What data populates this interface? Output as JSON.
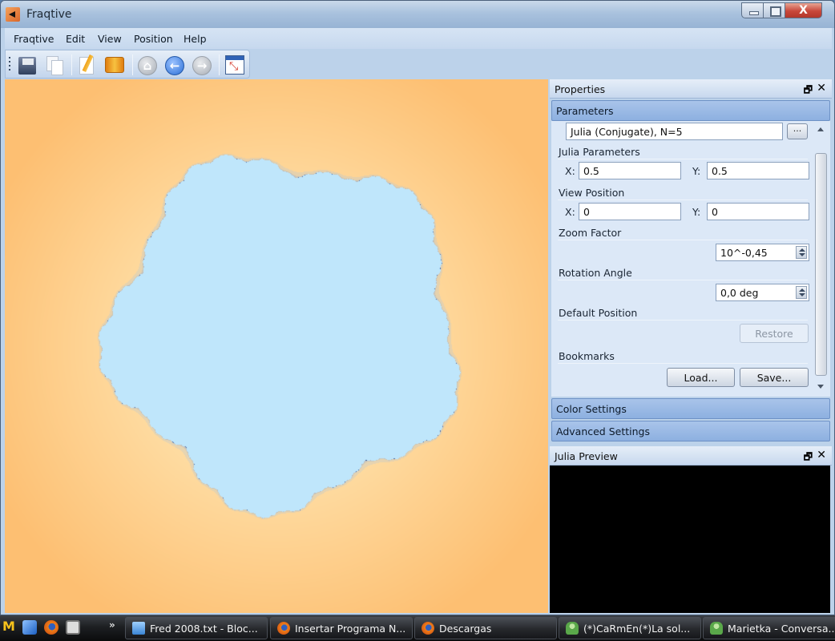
{
  "window": {
    "title": "Fraqtive",
    "close_glyph": "X"
  },
  "menu": {
    "items": [
      {
        "label": "Fraqtive"
      },
      {
        "label": "Edit"
      },
      {
        "label": "View"
      },
      {
        "label": "Position"
      },
      {
        "label": "Help"
      }
    ]
  },
  "toolbar": {
    "buttons": [
      {
        "icon": "save-icon"
      },
      {
        "icon": "copy-icon"
      },
      {
        "icon": "edit-icon"
      },
      {
        "icon": "color-icon"
      },
      {
        "icon": "home-icon",
        "glyph": "⌂"
      },
      {
        "icon": "back-arrow-icon",
        "glyph": "←"
      },
      {
        "icon": "forward-arrow-icon",
        "glyph": "→"
      },
      {
        "icon": "fullscreen-icon"
      }
    ]
  },
  "fractal": {
    "type": "Julia (Conjugate)",
    "n": 5,
    "c_re": 0.5,
    "c_im": 0.5,
    "colors": {
      "background_outer": "#fdbf72",
      "background_inner": "#fff3c8",
      "set_light": "#bfe6fb",
      "set_mid": "#5b8ee0",
      "set_dark": "#0a1436"
    }
  },
  "properties": {
    "title": "Properties",
    "float_glyph": "🗗",
    "close_glyph": "✕",
    "parameters_header": "Parameters",
    "fractal_type_value": "Julia (Conjugate), N=5",
    "dots_label": "...",
    "julia_parameters_label": "Julia Parameters",
    "julia_x_label": "X:",
    "julia_x_value": "0.5",
    "julia_y_label": "Y:",
    "julia_y_value": "0.5",
    "view_position_label": "View Position",
    "view_x_label": "X:",
    "view_x_value": "0",
    "view_y_label": "Y:",
    "view_y_value": "0",
    "zoom_factor_label": "Zoom Factor",
    "zoom_factor_value": "10^-0,45",
    "rotation_angle_label": "Rotation Angle",
    "rotation_angle_value": "0,0 deg",
    "default_position_label": "Default Position",
    "restore_label": "Restore",
    "bookmarks_label": "Bookmarks",
    "load_label": "Load...",
    "save_label": "Save...",
    "color_settings_header": "Color Settings",
    "advanced_settings_header": "Advanced Settings"
  },
  "julia_preview": {
    "title": "Julia Preview",
    "float_glyph": "🗗",
    "close_glyph": "✕"
  },
  "taskbar": {
    "quick_launch": [
      "gmail-icon",
      "outlook-icon",
      "firefox-icon",
      "settings-icon"
    ],
    "overflow_glyph": "»",
    "items": [
      {
        "label": "Fred 2008.txt - Bloc...",
        "icon": "notepad-icon"
      },
      {
        "label": "Insertar Programa N...",
        "icon": "firefox-icon"
      },
      {
        "label": "Descargas",
        "icon": "firefox-icon"
      },
      {
        "label": "(*)CaRmEn(*)La sol...",
        "icon": "msn-icon"
      },
      {
        "label": "Marietka - Conversa...",
        "icon": "msn-icon"
      }
    ]
  }
}
